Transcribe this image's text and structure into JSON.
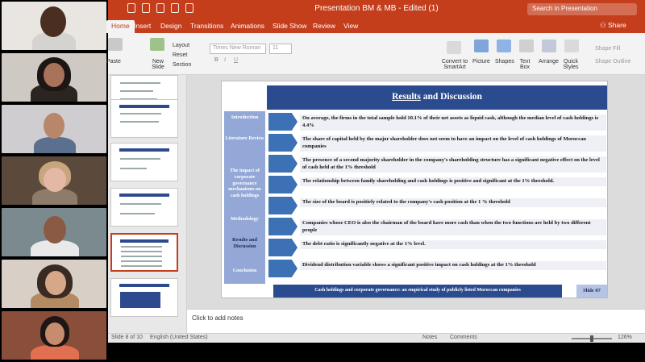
{
  "app": {
    "window_title": "Presentation BM & MB - Edited (1)",
    "search_placeholder": "Search in Presentation",
    "share_label": "Share"
  },
  "ribbon_tabs": [
    "Home",
    "Insert",
    "Design",
    "Transitions",
    "Animations",
    "Slide Show",
    "Review",
    "View"
  ],
  "ribbon": {
    "paste": "Paste",
    "new_slide": "New Slide",
    "layout": "Layout",
    "reset": "Reset",
    "section": "Section",
    "font_name": "Times New Roman",
    "font_size": "11",
    "convert_smartart": "Convert to SmartArt",
    "picture": "Picture",
    "shapes": "Shapes",
    "text_box": "Text Box",
    "arrange": "Arrange",
    "quick_styles": "Quick Styles",
    "shape_fill": "Shape Fill",
    "shape_outline": "Shape Outline"
  },
  "slide": {
    "title_underlined": "Results",
    "title_rest": " and Discussion",
    "left_items": [
      "Introduction",
      "Literature Review",
      "The impact of corporate governance mechanisms on cash holdings",
      "Methodology",
      "Results and Discussion",
      "Conclusion"
    ],
    "rows": [
      "On average, the firms in the total sample hold 10.1% of their net assets as liquid cash, although the median level of cash holdings is 4.4%",
      "The share of capital held by the major shareholder does not seem to have an impact on the level of cash holdings of Moroccan companies",
      "The presence of a second majority shareholder in the company's shareholding structure has a significant negative effect on the level of cash held at the 1% threshold",
      "The relationship between family shareholding and cash holdings is positive and significant at the 1% threshold.",
      "The size of the board is positiely related to the company's cash position at the 1 % threshold",
      "Companies whose CEO is also the chairman of the board have more cash than when the two functions are held by two different people",
      "The debt ratio is significantly negative at the 1% level.",
      "Dividend distribution variable shows a significant positive impact on cash holdings at the 1% threshold"
    ],
    "footer": "Cash holdings and corporate governance: an empirical study of publicly listed Moroccan companies",
    "slide_number": "Slide 07"
  },
  "notes_placeholder": "Click to add notes",
  "status": {
    "slide_count": "Slide 8 of 10",
    "language": "English (United States)",
    "notes_label": "Notes",
    "comments_label": "Comments",
    "zoom": "126%"
  },
  "colors": {
    "accent": "#c43e1c",
    "slide_title_bg": "#2a4b8d",
    "arrow": "#3c71b5",
    "left_column": "#93a8d6"
  }
}
